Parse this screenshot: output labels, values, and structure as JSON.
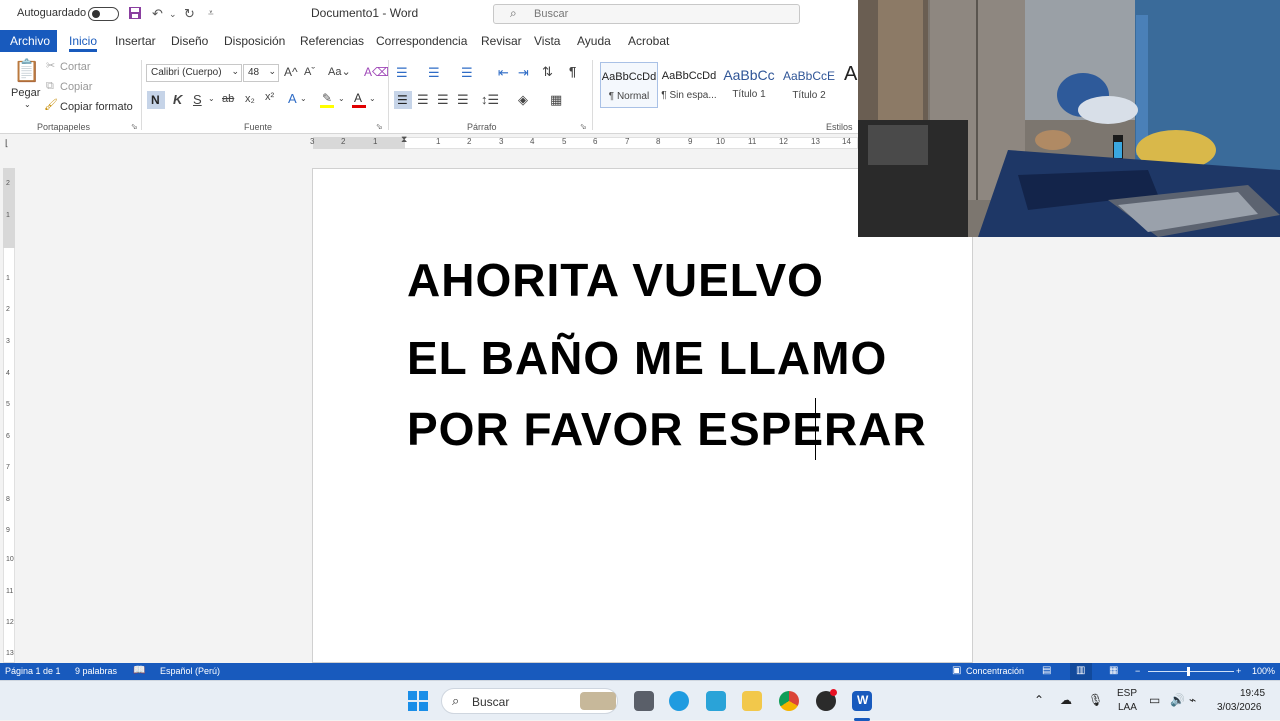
{
  "titlebar": {
    "autosave_label": "Autoguardado",
    "doc_title": "Documento1  -  Word",
    "search_placeholder": "Buscar"
  },
  "menu": {
    "tabs": [
      "Archivo",
      "Inicio",
      "Insertar",
      "Diseño",
      "Disposición",
      "Referencias",
      "Correspondencia",
      "Revisar",
      "Vista",
      "Ayuda",
      "Acrobat"
    ],
    "active_tab": "Inicio"
  },
  "ribbon": {
    "clipboard": {
      "paste": "Pegar",
      "cut": "Cortar",
      "copy": "Copiar",
      "format_painter": "Copiar formato",
      "group": "Portapapeles"
    },
    "font": {
      "family": "Calibri (Cuerpo)",
      "size": "48",
      "bold": "N",
      "italic": "K",
      "underline": "S",
      "group": "Fuente"
    },
    "paragraph": {
      "group": "Párrafo"
    },
    "styles": {
      "group": "Estilos",
      "items": [
        {
          "preview": "AaBbCcDd",
          "name": "¶ Normal"
        },
        {
          "preview": "AaBbCcDd",
          "name": "¶ Sin espa..."
        },
        {
          "preview": "AaBbCc",
          "name": "Título 1"
        },
        {
          "preview": "AaBbCcE",
          "name": "Título 2"
        }
      ]
    }
  },
  "ruler": {
    "h_numbers": [
      "3",
      "2",
      "1",
      "1",
      "2",
      "3",
      "4",
      "5",
      "6",
      "7",
      "8",
      "9",
      "10",
      "11",
      "12",
      "13",
      "14"
    ],
    "v_numbers": [
      "2",
      "1",
      "1",
      "2",
      "3",
      "4",
      "5",
      "6",
      "7",
      "8",
      "9",
      "10",
      "11",
      "12",
      "13"
    ]
  },
  "document": {
    "paragraphs": [
      "AHORITA VUELVO",
      "EL BAÑO ME LLAMO",
      "POR FAVOR ESPERAR"
    ]
  },
  "statusbar": {
    "page": "Página 1 de 1",
    "words": "9 palabras",
    "language": "Español (Perú)",
    "focus": "Concentración",
    "zoom": "100%"
  },
  "taskbar": {
    "search": "Buscar",
    "lang_top": "ESP",
    "lang_bottom": "LAA",
    "time": "19:45",
    "date": "3/03/2026"
  },
  "colors": {
    "accent": "#185abd",
    "page": "#ffffff",
    "canvas": "#f3f3f3"
  }
}
